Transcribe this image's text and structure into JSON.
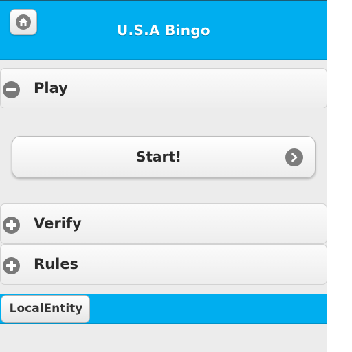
{
  "header": {
    "title": "U.S.A Bingo",
    "home_icon": "home-icon"
  },
  "sections": {
    "play": {
      "label": "Play",
      "expanded": true,
      "icon": "minus-icon"
    },
    "verify": {
      "label": "Verify",
      "expanded": false,
      "icon": "plus-icon"
    },
    "rules": {
      "label": "Rules",
      "expanded": false,
      "icon": "plus-icon"
    }
  },
  "play_content": {
    "start_label": "Start!",
    "start_icon": "chevron-right-icon"
  },
  "footer": {
    "local_label": "LocalEntity"
  },
  "colors": {
    "accent": "#00aeef",
    "icon_gray": "#797979",
    "text": "#2a2a2a"
  }
}
